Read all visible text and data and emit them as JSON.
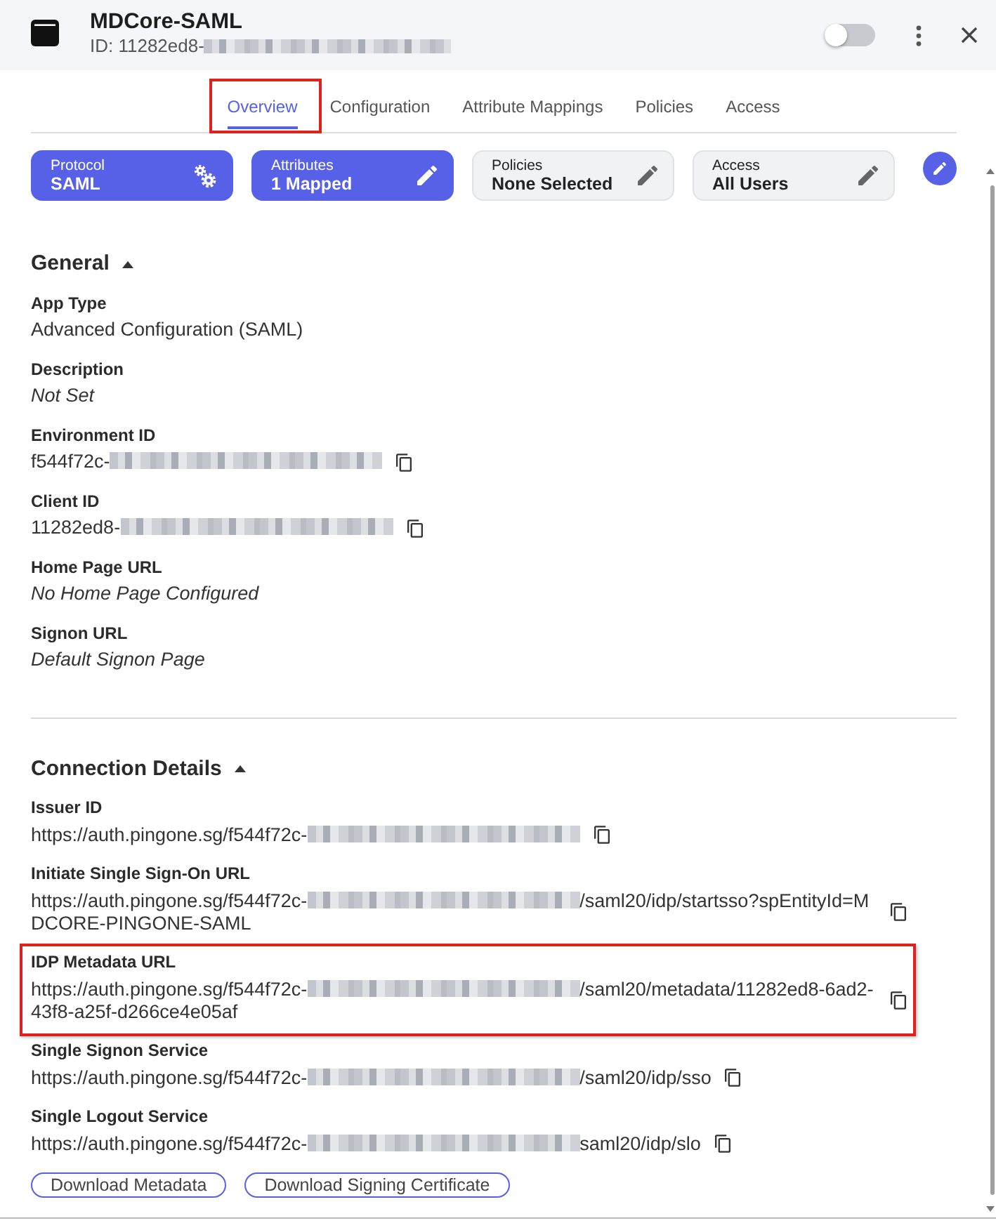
{
  "header": {
    "title": "MDCore-SAML",
    "id_text": "ID: 11282ed8-",
    "id_redacted": true,
    "enabled": false
  },
  "tabs": [
    {
      "label": "Overview",
      "selected": true,
      "highlighted": true
    },
    {
      "label": "Configuration",
      "selected": false,
      "highlighted": false
    },
    {
      "label": "Attribute Mappings",
      "selected": false,
      "highlighted": false
    },
    {
      "label": "Policies",
      "selected": false,
      "highlighted": false
    },
    {
      "label": "Access",
      "selected": false,
      "highlighted": false
    }
  ],
  "cards": [
    {
      "label": "Protocol",
      "value": "SAML",
      "kind": "fixed",
      "configured": true
    },
    {
      "label": "Attributes",
      "value": "1 Mapped",
      "kind": "editable",
      "configured": true
    },
    {
      "label": "Policies",
      "value": "None Selected",
      "kind": "editable",
      "configured": false
    },
    {
      "label": "Access",
      "value": "All Users",
      "kind": "editable",
      "configured": false
    }
  ],
  "sections": [
    {
      "title": "General",
      "expanded": true,
      "fields": [
        {
          "label": "App Type",
          "value": "Advanced Configuration (SAML)",
          "unset": false,
          "redacted": false,
          "copyable": false,
          "highlighted": false
        },
        {
          "label": "Description",
          "value": "Not Set",
          "unset": true,
          "redacted": false,
          "copyable": false,
          "highlighted": false
        },
        {
          "label": "Environment ID",
          "value": "f544f72c-",
          "unset": false,
          "redacted": true,
          "copyable": true,
          "highlighted": false
        },
        {
          "label": "Client ID",
          "value": "11282ed8-",
          "unset": false,
          "redacted": true,
          "copyable": true,
          "highlighted": false
        },
        {
          "label": "Home Page URL",
          "value": "No Home Page Configured",
          "unset": true,
          "redacted": false,
          "copyable": false,
          "highlighted": false
        },
        {
          "label": "Signon URL",
          "value": "Default Signon Page",
          "unset": true,
          "redacted": false,
          "copyable": false,
          "highlighted": false
        }
      ]
    },
    {
      "title": "Connection Details",
      "expanded": true,
      "fields": [
        {
          "label": "Issuer ID",
          "value": "https://auth.pingone.sg/f544f72c-",
          "unset": false,
          "redacted": true,
          "copyable": true,
          "highlighted": false
        },
        {
          "label": "Initiate Single Sign-On URL",
          "value": "https://auth.pingone.sg/f544f72c-",
          "value_end": "/saml20/idp/startsso?spEntityId=MDCORE-PINGONE-SAML",
          "unset": false,
          "redacted": true,
          "copyable": true,
          "highlighted": false
        },
        {
          "label": "IDP Metadata URL",
          "value": "https://auth.pingone.sg/f544f72c-",
          "value_end": "/saml20/metadata/11282ed8-6ad2-43f8-a25f-d266ce4e05af",
          "unset": false,
          "redacted": true,
          "copyable": true,
          "highlighted": true
        },
        {
          "label": "Single Signon Service",
          "value": "https://auth.pingone.sg/f544f72c-",
          "value_end": "/saml20/idp/sso",
          "unset": false,
          "redacted": true,
          "copyable": true,
          "highlighted": false
        },
        {
          "label": "Single Logout Service",
          "value": "https://auth.pingone.sg/f544f72c-",
          "value_end": "saml20/idp/slo",
          "unset": false,
          "redacted": true,
          "copyable": true,
          "highlighted": false
        }
      ]
    }
  ],
  "buttons": [
    "Download Metadata",
    "Download Signing Certificate"
  ]
}
